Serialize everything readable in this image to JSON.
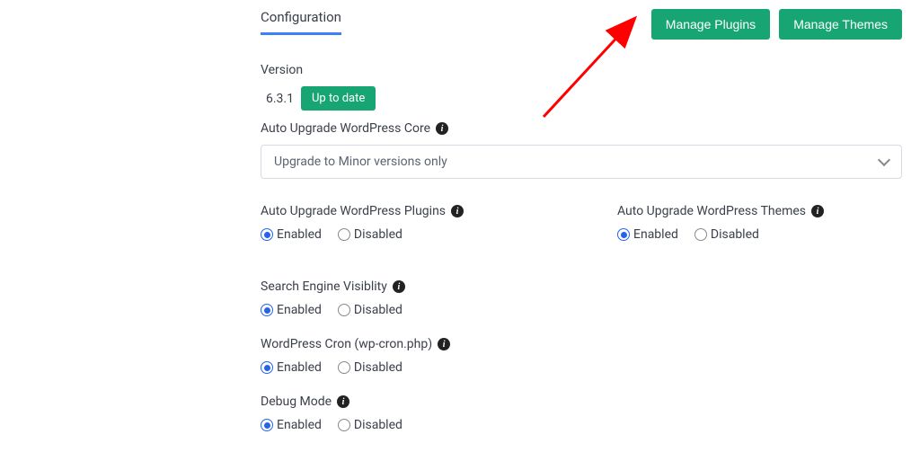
{
  "header": {
    "tab": "Configuration"
  },
  "buttons": {
    "manage_plugins": "Manage Plugins",
    "manage_themes": "Manage Themes"
  },
  "version": {
    "label": "Version",
    "value": "6.3.1",
    "status": "Up to date"
  },
  "auto_core": {
    "label": "Auto Upgrade WordPress Core",
    "selected": "Upgrade to Minor versions only"
  },
  "auto_plugins": {
    "label": "Auto Upgrade WordPress Plugins",
    "enabled": "Enabled",
    "disabled": "Disabled"
  },
  "auto_themes": {
    "label": "Auto Upgrade WordPress Themes",
    "enabled": "Enabled",
    "disabled": "Disabled"
  },
  "search_visibility": {
    "label": "Search Engine Visiblity",
    "enabled": "Enabled",
    "disabled": "Disabled"
  },
  "cron": {
    "label": "WordPress Cron (wp-cron.php)",
    "enabled": "Enabled",
    "disabled": "Disabled"
  },
  "debug": {
    "label": "Debug Mode",
    "enabled": "Enabled",
    "disabled": "Disabled"
  }
}
